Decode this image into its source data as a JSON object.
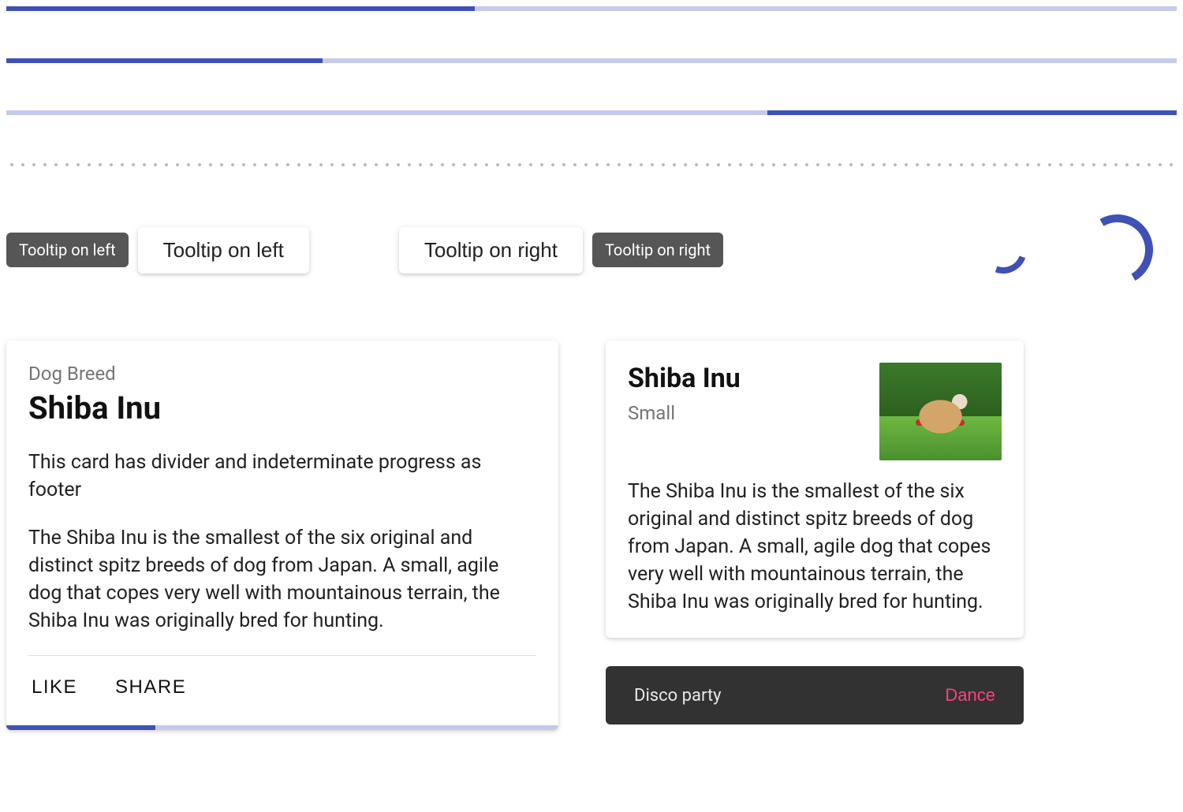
{
  "progress": {
    "bar1_percent": 40,
    "bar2_percent": 27,
    "query_percent": 35
  },
  "tooltips": {
    "chip_left": "Tooltip on left",
    "btn_left": "Tooltip on left",
    "btn_right": "Tooltip on right",
    "chip_right": "Tooltip on right"
  },
  "card1": {
    "subtitle": "Dog Breed",
    "title": "Shiba Inu",
    "para1": "This card has divider and indeterminate progress as footer",
    "para2": "The Shiba Inu is the smallest of the six original and distinct spitz breeds of dog from Japan. A small, agile dog that copes very well with mountainous terrain, the Shiba Inu was originally bred for hunting.",
    "like_label": "LIKE",
    "share_label": "SHARE"
  },
  "card2": {
    "title": "Shiba Inu",
    "subtitle": "Small",
    "body": "The Shiba Inu is the smallest of the six original and distinct spitz breeds of dog from Japan. A small, agile dog that copes very well with mountainous terrain, the Shiba Inu was originally bred for hunting."
  },
  "snackbar": {
    "message": "Disco party",
    "action": "Dance"
  }
}
